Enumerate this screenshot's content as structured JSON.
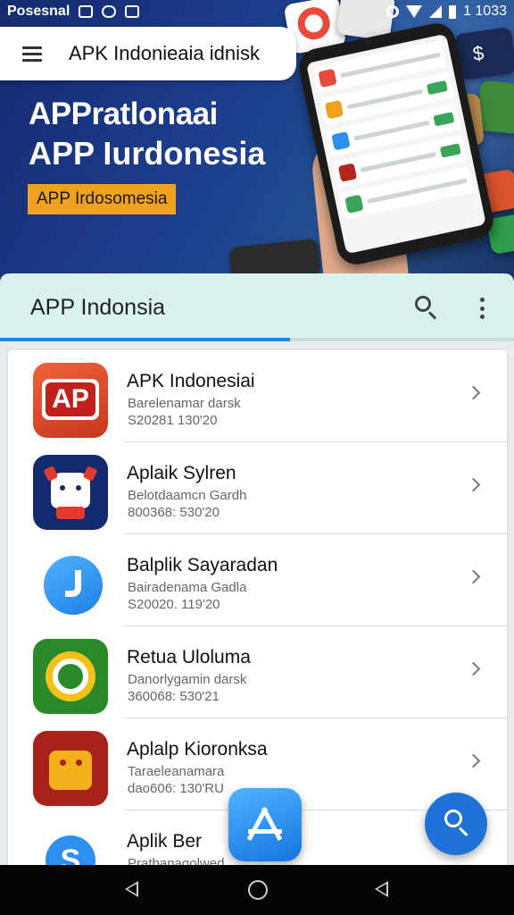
{
  "status_bar": {
    "carrier": "Posesnal",
    "time": "1 1033"
  },
  "header": {
    "search_text": "APK Indonieaia idnisk"
  },
  "hero": {
    "title_line1": "APPratlonaai",
    "title_line2": "APP Iurdonesia",
    "badge": "APP Irdosomesia"
  },
  "app_bar": {
    "title": "APP Indonsia",
    "progress": 0.565
  },
  "apps": [
    {
      "name": "APK Indonesiai",
      "subtitle": "Barelenamar darsk",
      "date": "S20281 130'20",
      "icon": "ap-logo-icon",
      "icon_text": "AP",
      "color": "#d8402a"
    },
    {
      "name": "Aplaik Sylren",
      "subtitle": "Belotdaamcn Gardh",
      "date": "800368: 530'20",
      "icon": "robot-icon",
      "icon_text": "",
      "color": "#132a6e"
    },
    {
      "name": "Balplik Sayaradan",
      "subtitle": "Bairadenama Gadla",
      "date": "S20020. 119'20",
      "icon": "music-note-icon",
      "icon_text": "",
      "color": "#2d8ff0"
    },
    {
      "name": "Retua Uloluma",
      "subtitle": "Danorlygamin darsk",
      "date": "360068: 530'21",
      "icon": "sync-arrows-icon",
      "icon_text": "",
      "color": "#2a7d2a"
    },
    {
      "name": "Aplalp Kioronksa",
      "subtitle": "Taraeleanamara",
      "date": "dao606: 130'RU",
      "icon": "android-box-icon",
      "icon_text": "",
      "color": "#b3261e"
    },
    {
      "name": "Aplik Ber",
      "subtitle": "Pratbanagolwed",
      "date": "",
      "icon": "dollar-icon",
      "icon_text": "S",
      "color": "#2d8ff0"
    }
  ]
}
